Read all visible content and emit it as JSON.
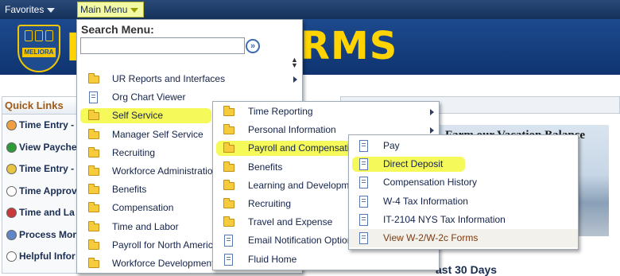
{
  "topbar": {
    "favorites_label": "Favorites",
    "main_menu_label": "Main Menu"
  },
  "banner": {
    "seal_text": "MELIORA",
    "title_fragment_left": "H",
    "title_fragment_right": "RMS"
  },
  "search": {
    "title": "Search Menu:",
    "value": ""
  },
  "main_menu": {
    "items": [
      {
        "label": "UR Reports and Interfaces",
        "icon": "folder-icon",
        "has_submenu": true
      },
      {
        "label": "Org Chart Viewer",
        "icon": "document-icon",
        "has_submenu": false
      },
      {
        "label": "Self Service",
        "icon": "folder-icon",
        "has_submenu": true,
        "highlighted": true
      },
      {
        "label": "Manager Self Service",
        "icon": "folder-icon",
        "has_submenu": true
      },
      {
        "label": "Recruiting",
        "icon": "folder-icon",
        "has_submenu": true
      },
      {
        "label": "Workforce Administration",
        "icon": "folder-icon",
        "has_submenu": true
      },
      {
        "label": "Benefits",
        "icon": "folder-icon",
        "has_submenu": true
      },
      {
        "label": "Compensation",
        "icon": "folder-icon",
        "has_submenu": true
      },
      {
        "label": "Time and Labor",
        "icon": "folder-icon",
        "has_submenu": true
      },
      {
        "label": "Payroll for North America",
        "icon": "folder-icon",
        "has_submenu": true
      },
      {
        "label": "Workforce Development",
        "icon": "folder-icon",
        "has_submenu": true
      }
    ]
  },
  "self_service_menu": {
    "items": [
      {
        "label": "Time Reporting",
        "icon": "folder-icon",
        "has_submenu": true
      },
      {
        "label": "Personal Information",
        "icon": "folder-icon",
        "has_submenu": true
      },
      {
        "label": "Payroll and Compensation",
        "icon": "folder-icon",
        "has_submenu": true,
        "highlighted": true
      },
      {
        "label": "Benefits",
        "icon": "folder-icon",
        "has_submenu": true
      },
      {
        "label": "Learning and Development",
        "icon": "folder-icon",
        "has_submenu": true
      },
      {
        "label": "Recruiting",
        "icon": "folder-icon",
        "has_submenu": true
      },
      {
        "label": "Travel and Expense",
        "icon": "folder-icon",
        "has_submenu": true
      },
      {
        "label": "Email Notification Options",
        "icon": "document-icon",
        "has_submenu": false
      },
      {
        "label": "Fluid Home",
        "icon": "document-icon",
        "has_submenu": false
      }
    ]
  },
  "payroll_menu": {
    "items": [
      {
        "label": "Pay",
        "icon": "document-icon"
      },
      {
        "label": "Direct Deposit",
        "icon": "document-icon",
        "highlighted": true
      },
      {
        "label": "Compensation History",
        "icon": "document-icon"
      },
      {
        "label": "W-4 Tax Information",
        "icon": "document-icon"
      },
      {
        "label": "IT-2104 NYS Tax Information",
        "icon": "document-icon"
      },
      {
        "label": "View W-2/W-2c Forms",
        "icon": "document-icon",
        "hovered": true
      }
    ]
  },
  "quick_links": {
    "title": "Quick Links",
    "items": [
      {
        "label": "Time Entry -",
        "color": "#f0a040"
      },
      {
        "label": "View Payche",
        "color": "#2e9a3a"
      },
      {
        "label": "Time Entry -",
        "color": "#e8c440"
      },
      {
        "label": "Time Approv",
        "color": "#ffffff"
      },
      {
        "label": "Time and La",
        "color": "#c83a3a"
      },
      {
        "label": "Process Mor",
        "color": "#5f86c6"
      },
      {
        "label": "Helpful Infor",
        "color": "#ffffff"
      }
    ]
  },
  "background": {
    "vacation_title": "Farm our Vacation Balance",
    "last_30_label": "ast 30 Days"
  },
  "colors": {
    "highlight_yellow": "#f6f95a",
    "nav_blue": "#15325c",
    "brand_gold": "#ffd400"
  }
}
